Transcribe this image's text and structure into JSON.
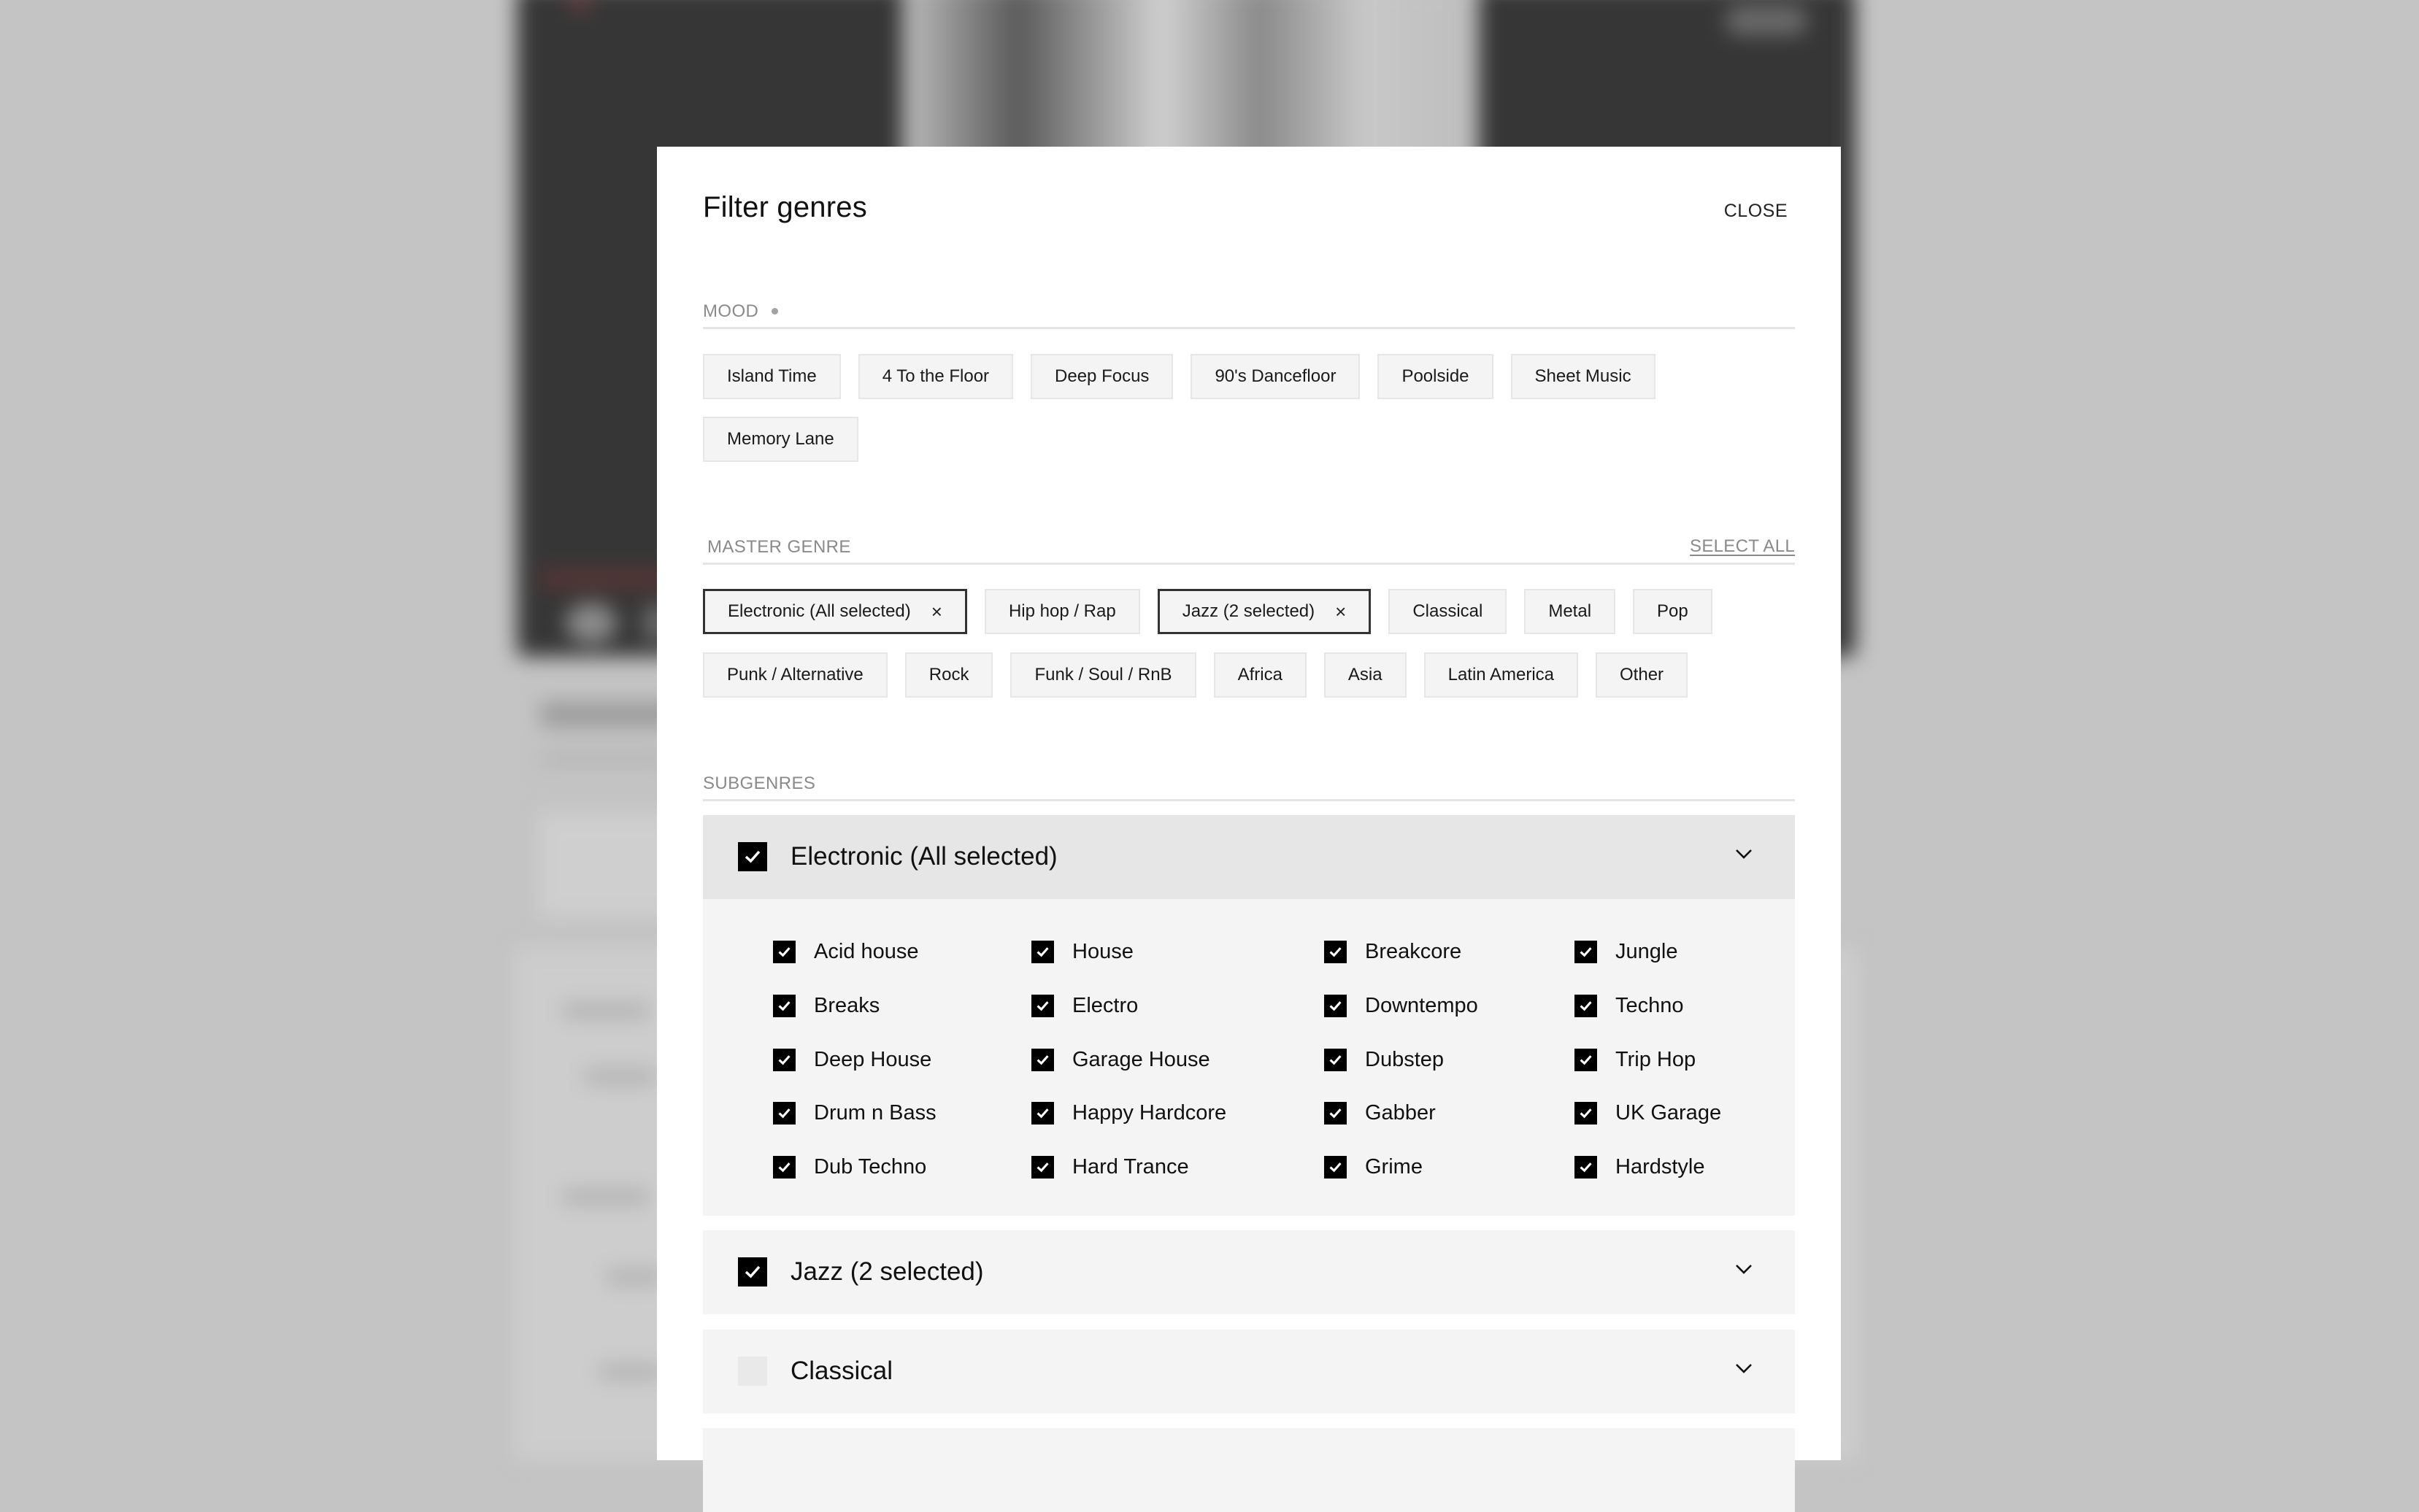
{
  "dialog": {
    "title": "Filter genres",
    "close_label": "CLOSE"
  },
  "mood": {
    "label": "MOOD",
    "chips": [
      {
        "label": "Island Time",
        "selected": false
      },
      {
        "label": "4 To the Floor",
        "selected": false
      },
      {
        "label": "Deep Focus",
        "selected": false
      },
      {
        "label": "90's Dancefloor",
        "selected": false
      },
      {
        "label": "Poolside",
        "selected": false
      },
      {
        "label": "Sheet Music",
        "selected": false
      },
      {
        "label": "Memory Lane",
        "selected": false
      }
    ]
  },
  "master_genre": {
    "label": "MASTER GENRE",
    "select_all_label": "SELECT ALL",
    "remove_icon": "×",
    "chips": [
      {
        "label": "Electronic (All selected)",
        "selected": true
      },
      {
        "label": "Hip hop / Rap",
        "selected": false
      },
      {
        "label": "Jazz (2 selected)",
        "selected": true
      },
      {
        "label": "Classical",
        "selected": false
      },
      {
        "label": "Metal",
        "selected": false
      },
      {
        "label": "Pop",
        "selected": false
      },
      {
        "label": "Punk / Alternative",
        "selected": false
      },
      {
        "label": "Rock",
        "selected": false
      },
      {
        "label": "Funk / Soul / RnB",
        "selected": false
      },
      {
        "label": "Africa",
        "selected": false
      },
      {
        "label": "Asia",
        "selected": false
      },
      {
        "label": "Latin America",
        "selected": false
      },
      {
        "label": "Other",
        "selected": false
      }
    ]
  },
  "subgenres": {
    "label": "SUBGENRES",
    "groups": [
      {
        "label": "Electronic (All selected)",
        "checked": true,
        "expanded": true,
        "items": [
          {
            "label": "Acid house",
            "checked": true
          },
          {
            "label": "House",
            "checked": true
          },
          {
            "label": "Breakcore",
            "checked": true
          },
          {
            "label": "Jungle",
            "checked": true
          },
          {
            "label": "Breaks",
            "checked": true
          },
          {
            "label": "Electro",
            "checked": true
          },
          {
            "label": "Downtempo",
            "checked": true
          },
          {
            "label": "Techno",
            "checked": true
          },
          {
            "label": "Deep House",
            "checked": true
          },
          {
            "label": "Garage House",
            "checked": true
          },
          {
            "label": "Dubstep",
            "checked": true
          },
          {
            "label": "Trip Hop",
            "checked": true
          },
          {
            "label": "Drum n Bass",
            "checked": true
          },
          {
            "label": "Happy Hardcore",
            "checked": true
          },
          {
            "label": "Gabber",
            "checked": true
          },
          {
            "label": "UK Garage",
            "checked": true
          },
          {
            "label": "Dub Techno",
            "checked": true
          },
          {
            "label": "Hard Trance",
            "checked": true
          },
          {
            "label": "Grime",
            "checked": true
          },
          {
            "label": "Hardstyle",
            "checked": true
          }
        ]
      },
      {
        "label": "Jazz (2 selected)",
        "checked": true,
        "expanded": false
      },
      {
        "label": "Classical",
        "checked": false,
        "expanded": false
      },
      {
        "label": "",
        "checked": false,
        "expanded": false
      }
    ]
  },
  "colors": {
    "overlay_bg": "#c4c4c4",
    "chip_bg": "#f4f4f4",
    "selected_border": "#333333",
    "accordion_open_bg": "#e6e6e6",
    "checkbox_on": "#000000",
    "checkbox_off": "#e9e9e9",
    "muted_text": "#8a8a8a"
  }
}
